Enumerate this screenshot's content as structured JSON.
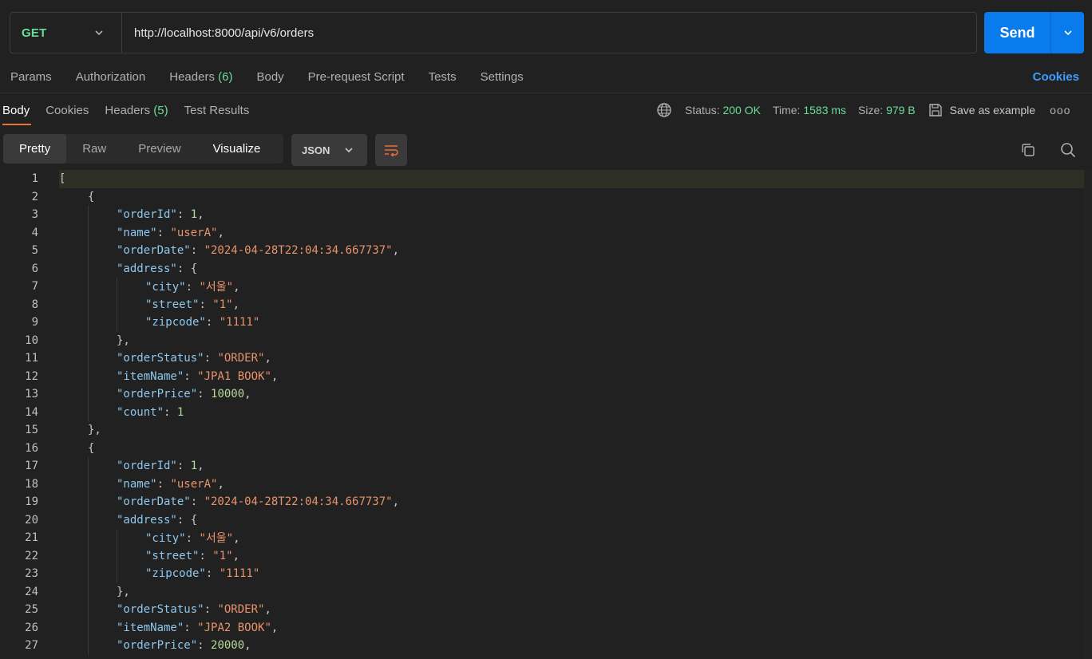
{
  "request": {
    "method": "GET",
    "url": "http://localhost:8000/api/v6/orders",
    "send_label": "Send"
  },
  "request_tabs": [
    {
      "label": "Params",
      "count": ""
    },
    {
      "label": "Authorization",
      "count": ""
    },
    {
      "label": "Headers",
      "count": "(6)"
    },
    {
      "label": "Body",
      "count": ""
    },
    {
      "label": "Pre-request Script",
      "count": ""
    },
    {
      "label": "Tests",
      "count": ""
    },
    {
      "label": "Settings",
      "count": ""
    }
  ],
  "cookies_link": "Cookies",
  "response_tabs": [
    {
      "label": "Body",
      "count": ""
    },
    {
      "label": "Cookies",
      "count": ""
    },
    {
      "label": "Headers",
      "count": "(5)"
    },
    {
      "label": "Test Results",
      "count": ""
    }
  ],
  "status": {
    "status_label": "Status:",
    "status_value": "200 OK",
    "time_label": "Time:",
    "time_value": "1583 ms",
    "size_label": "Size:",
    "size_value": "979 B",
    "save_example": "Save as example",
    "more": "ooo"
  },
  "view_modes": [
    "Pretty",
    "Raw",
    "Preview",
    "Visualize"
  ],
  "format_select": "JSON",
  "icons": {
    "method_dropdown": "chevron-down-icon",
    "send_dropdown": "chevron-down-icon",
    "globe": "globe-icon",
    "save": "save-icon",
    "wrap": "wrap-lines-icon",
    "copy": "copy-icon",
    "search": "search-icon"
  },
  "colors": {
    "background": "#212121",
    "send_button": "#097bed",
    "method_green": "#6bdd9a",
    "cookies_blue": "#3d9dff",
    "active_tab_underline": "#f26b3a",
    "json_key": "#8fc8ee",
    "json_string": "#e9936b",
    "json_number": "#b5d89b"
  },
  "code_lines": [
    {
      "n": "1",
      "indent": 0,
      "tokens": [
        {
          "t": "p",
          "v": "["
        }
      ]
    },
    {
      "n": "2",
      "indent": 1,
      "tokens": [
        {
          "t": "p",
          "v": "{"
        }
      ]
    },
    {
      "n": "3",
      "indent": 2,
      "tokens": [
        {
          "t": "k",
          "v": "\"orderId\""
        },
        {
          "t": "p",
          "v": ": "
        },
        {
          "t": "n",
          "v": "1"
        },
        {
          "t": "p",
          "v": ","
        }
      ]
    },
    {
      "n": "4",
      "indent": 2,
      "tokens": [
        {
          "t": "k",
          "v": "\"name\""
        },
        {
          "t": "p",
          "v": ": "
        },
        {
          "t": "s",
          "v": "\"userA\""
        },
        {
          "t": "p",
          "v": ","
        }
      ]
    },
    {
      "n": "5",
      "indent": 2,
      "tokens": [
        {
          "t": "k",
          "v": "\"orderDate\""
        },
        {
          "t": "p",
          "v": ": "
        },
        {
          "t": "s",
          "v": "\"2024-04-28T22:04:34.667737\""
        },
        {
          "t": "p",
          "v": ","
        }
      ]
    },
    {
      "n": "6",
      "indent": 2,
      "tokens": [
        {
          "t": "k",
          "v": "\"address\""
        },
        {
          "t": "p",
          "v": ": {"
        }
      ]
    },
    {
      "n": "7",
      "indent": 3,
      "tokens": [
        {
          "t": "k",
          "v": "\"city\""
        },
        {
          "t": "p",
          "v": ": "
        },
        {
          "t": "s",
          "v": "\"서울\""
        },
        {
          "t": "p",
          "v": ","
        }
      ]
    },
    {
      "n": "8",
      "indent": 3,
      "tokens": [
        {
          "t": "k",
          "v": "\"street\""
        },
        {
          "t": "p",
          "v": ": "
        },
        {
          "t": "s",
          "v": "\"1\""
        },
        {
          "t": "p",
          "v": ","
        }
      ]
    },
    {
      "n": "9",
      "indent": 3,
      "tokens": [
        {
          "t": "k",
          "v": "\"zipcode\""
        },
        {
          "t": "p",
          "v": ": "
        },
        {
          "t": "s",
          "v": "\"1111\""
        }
      ]
    },
    {
      "n": "10",
      "indent": 2,
      "tokens": [
        {
          "t": "p",
          "v": "},"
        }
      ]
    },
    {
      "n": "11",
      "indent": 2,
      "tokens": [
        {
          "t": "k",
          "v": "\"orderStatus\""
        },
        {
          "t": "p",
          "v": ": "
        },
        {
          "t": "s",
          "v": "\"ORDER\""
        },
        {
          "t": "p",
          "v": ","
        }
      ]
    },
    {
      "n": "12",
      "indent": 2,
      "tokens": [
        {
          "t": "k",
          "v": "\"itemName\""
        },
        {
          "t": "p",
          "v": ": "
        },
        {
          "t": "s",
          "v": "\"JPA1 BOOK\""
        },
        {
          "t": "p",
          "v": ","
        }
      ]
    },
    {
      "n": "13",
      "indent": 2,
      "tokens": [
        {
          "t": "k",
          "v": "\"orderPrice\""
        },
        {
          "t": "p",
          "v": ": "
        },
        {
          "t": "n",
          "v": "10000"
        },
        {
          "t": "p",
          "v": ","
        }
      ]
    },
    {
      "n": "14",
      "indent": 2,
      "tokens": [
        {
          "t": "k",
          "v": "\"count\""
        },
        {
          "t": "p",
          "v": ": "
        },
        {
          "t": "n",
          "v": "1"
        }
      ]
    },
    {
      "n": "15",
      "indent": 1,
      "tokens": [
        {
          "t": "p",
          "v": "},"
        }
      ]
    },
    {
      "n": "16",
      "indent": 1,
      "tokens": [
        {
          "t": "p",
          "v": "{"
        }
      ]
    },
    {
      "n": "17",
      "indent": 2,
      "tokens": [
        {
          "t": "k",
          "v": "\"orderId\""
        },
        {
          "t": "p",
          "v": ": "
        },
        {
          "t": "n",
          "v": "1"
        },
        {
          "t": "p",
          "v": ","
        }
      ]
    },
    {
      "n": "18",
      "indent": 2,
      "tokens": [
        {
          "t": "k",
          "v": "\"name\""
        },
        {
          "t": "p",
          "v": ": "
        },
        {
          "t": "s",
          "v": "\"userA\""
        },
        {
          "t": "p",
          "v": ","
        }
      ]
    },
    {
      "n": "19",
      "indent": 2,
      "tokens": [
        {
          "t": "k",
          "v": "\"orderDate\""
        },
        {
          "t": "p",
          "v": ": "
        },
        {
          "t": "s",
          "v": "\"2024-04-28T22:04:34.667737\""
        },
        {
          "t": "p",
          "v": ","
        }
      ]
    },
    {
      "n": "20",
      "indent": 2,
      "tokens": [
        {
          "t": "k",
          "v": "\"address\""
        },
        {
          "t": "p",
          "v": ": {"
        }
      ]
    },
    {
      "n": "21",
      "indent": 3,
      "tokens": [
        {
          "t": "k",
          "v": "\"city\""
        },
        {
          "t": "p",
          "v": ": "
        },
        {
          "t": "s",
          "v": "\"서울\""
        },
        {
          "t": "p",
          "v": ","
        }
      ]
    },
    {
      "n": "22",
      "indent": 3,
      "tokens": [
        {
          "t": "k",
          "v": "\"street\""
        },
        {
          "t": "p",
          "v": ": "
        },
        {
          "t": "s",
          "v": "\"1\""
        },
        {
          "t": "p",
          "v": ","
        }
      ]
    },
    {
      "n": "23",
      "indent": 3,
      "tokens": [
        {
          "t": "k",
          "v": "\"zipcode\""
        },
        {
          "t": "p",
          "v": ": "
        },
        {
          "t": "s",
          "v": "\"1111\""
        }
      ]
    },
    {
      "n": "24",
      "indent": 2,
      "tokens": [
        {
          "t": "p",
          "v": "},"
        }
      ]
    },
    {
      "n": "25",
      "indent": 2,
      "tokens": [
        {
          "t": "k",
          "v": "\"orderStatus\""
        },
        {
          "t": "p",
          "v": ": "
        },
        {
          "t": "s",
          "v": "\"ORDER\""
        },
        {
          "t": "p",
          "v": ","
        }
      ]
    },
    {
      "n": "26",
      "indent": 2,
      "tokens": [
        {
          "t": "k",
          "v": "\"itemName\""
        },
        {
          "t": "p",
          "v": ": "
        },
        {
          "t": "s",
          "v": "\"JPA2 BOOK\""
        },
        {
          "t": "p",
          "v": ","
        }
      ]
    },
    {
      "n": "27",
      "indent": 2,
      "tokens": [
        {
          "t": "k",
          "v": "\"orderPrice\""
        },
        {
          "t": "p",
          "v": ": "
        },
        {
          "t": "n",
          "v": "20000"
        },
        {
          "t": "p",
          "v": ","
        }
      ]
    }
  ]
}
